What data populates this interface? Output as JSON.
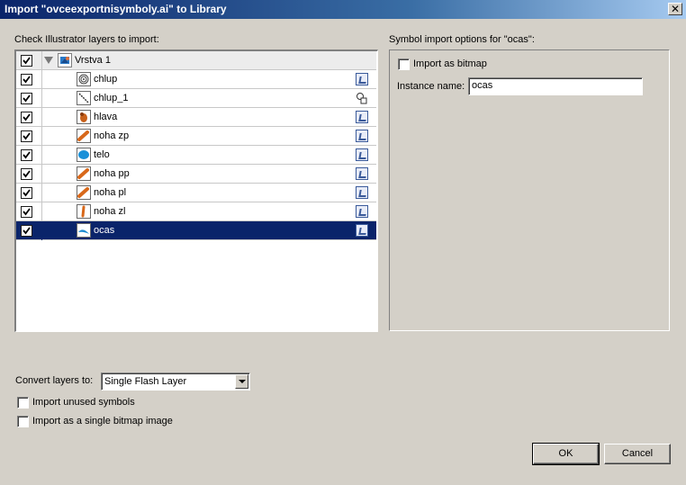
{
  "window": {
    "title": "Import \"ovceexportnisymboly.ai\" to Library",
    "close_glyph": "✕"
  },
  "layers": {
    "heading": "Check Illustrator layers to import:",
    "parent": {
      "name": "Vrstva 1",
      "checked": true,
      "icon": "layer-thumbnail"
    },
    "items": [
      {
        "name": "chlup",
        "checked": true,
        "thumb": "spiral",
        "symbol_type": "graphic"
      },
      {
        "name": "chlup_1",
        "checked": true,
        "thumb": "line",
        "symbol_type": "movie-clip"
      },
      {
        "name": "hlava",
        "checked": true,
        "thumb": "head",
        "symbol_type": "graphic"
      },
      {
        "name": "noha zp",
        "checked": true,
        "thumb": "leg",
        "symbol_type": "graphic"
      },
      {
        "name": "telo",
        "checked": true,
        "thumb": "body",
        "symbol_type": "graphic"
      },
      {
        "name": "noha pp",
        "checked": true,
        "thumb": "leg",
        "symbol_type": "graphic"
      },
      {
        "name": "noha pl",
        "checked": true,
        "thumb": "leg",
        "symbol_type": "graphic"
      },
      {
        "name": "noha zl",
        "checked": true,
        "thumb": "leg-small",
        "symbol_type": "graphic"
      },
      {
        "name": "ocas",
        "checked": true,
        "thumb": "tail",
        "symbol_type": "graphic",
        "selected": true
      }
    ]
  },
  "options": {
    "heading": "Symbol import options for \"ocas\":",
    "import_bitmap_label": "Import as bitmap",
    "import_bitmap_checked": false,
    "instance_name_label": "Instance name:",
    "instance_name_value": "ocas"
  },
  "bottom": {
    "convert_label": "Convert layers to:",
    "convert_value": "Single Flash Layer",
    "unused_symbols_label": "Import unused symbols",
    "unused_symbols_checked": false,
    "single_bitmap_label": "Import as a single bitmap image",
    "single_bitmap_checked": false
  },
  "buttons": {
    "ok": "OK",
    "cancel": "Cancel"
  },
  "colors": {
    "selection": "#0a246a",
    "dialog_bg": "#d4d0c8",
    "titlebar_start": "#0a246a",
    "titlebar_end": "#a6caf0"
  }
}
